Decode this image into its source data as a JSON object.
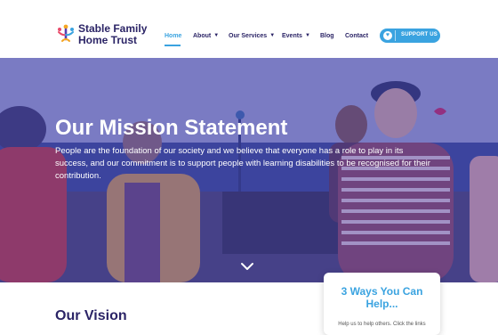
{
  "brand": {
    "name_line1": "Stable Family",
    "name_line2": "Home Trust"
  },
  "nav": {
    "home": "Home",
    "about": "About",
    "services": "Our Services",
    "events": "Events",
    "blog": "Blog",
    "contact": "Contact",
    "support_button": "SUPPORT US"
  },
  "icons": {
    "logo": "people-logo-icon",
    "heart": "heart-icon",
    "scroll_down": "chevron-down-icon"
  },
  "colors": {
    "accent": "#3aa3e0",
    "brand_dark": "#2b2466",
    "hero_overlay": "#3e308c"
  },
  "hero": {
    "title": "Our Mission Statement",
    "text": "People are the foundation of our society and we believe that everyone has a role to play in its success, and our commitment is to support people with learning disabilities to be recognised for their contribution."
  },
  "vision": {
    "title": "Our Vision"
  },
  "help_card": {
    "title": "3 Ways You Can Help...",
    "text": "Help us to help others. Click the links"
  }
}
